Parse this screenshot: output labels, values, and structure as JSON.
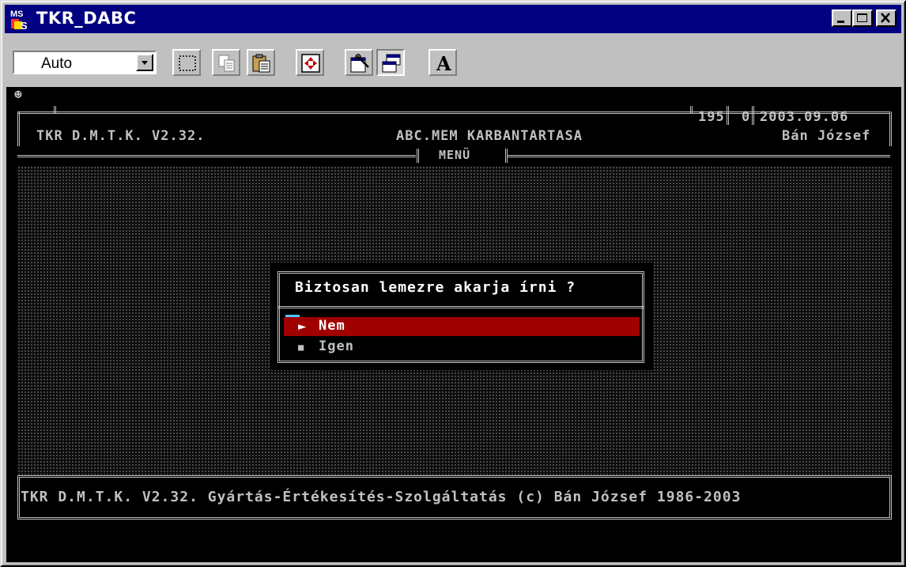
{
  "window": {
    "title": "TKR_DABC",
    "icon": "ms-dos-icon"
  },
  "toolbar": {
    "font_size_value": "Auto",
    "tools": [
      "mark-icon",
      "copy-icon",
      "paste-icon",
      "fullscreen-icon",
      "properties-icon",
      "background-icon"
    ],
    "font_button_label": "A"
  },
  "header": {
    "app_name": "TKR D.M.T.K. V2.32.",
    "screen_title": "ABC.MEM KARBANTARTASA",
    "menu_label": "MENÜ",
    "field_number": "195",
    "field_zero": "0",
    "date": "2003.09.06",
    "user": "Bán József"
  },
  "dialog": {
    "question": "Biztosan lemezre akarja írni ?",
    "options": [
      {
        "label": "Nem",
        "marker": "►",
        "selected": true
      },
      {
        "label": "Igen",
        "marker": "■",
        "selected": false
      }
    ]
  },
  "footer": {
    "text": "TKR D.M.T.K. V2.32. Gyártás-Értékesítés-Szolgáltatás (c) Bán József 1986-2003"
  },
  "colors": {
    "titlebar": "#000080",
    "console_bg": "#000000",
    "selection": "#a00000",
    "text": "#c0c0c0"
  }
}
